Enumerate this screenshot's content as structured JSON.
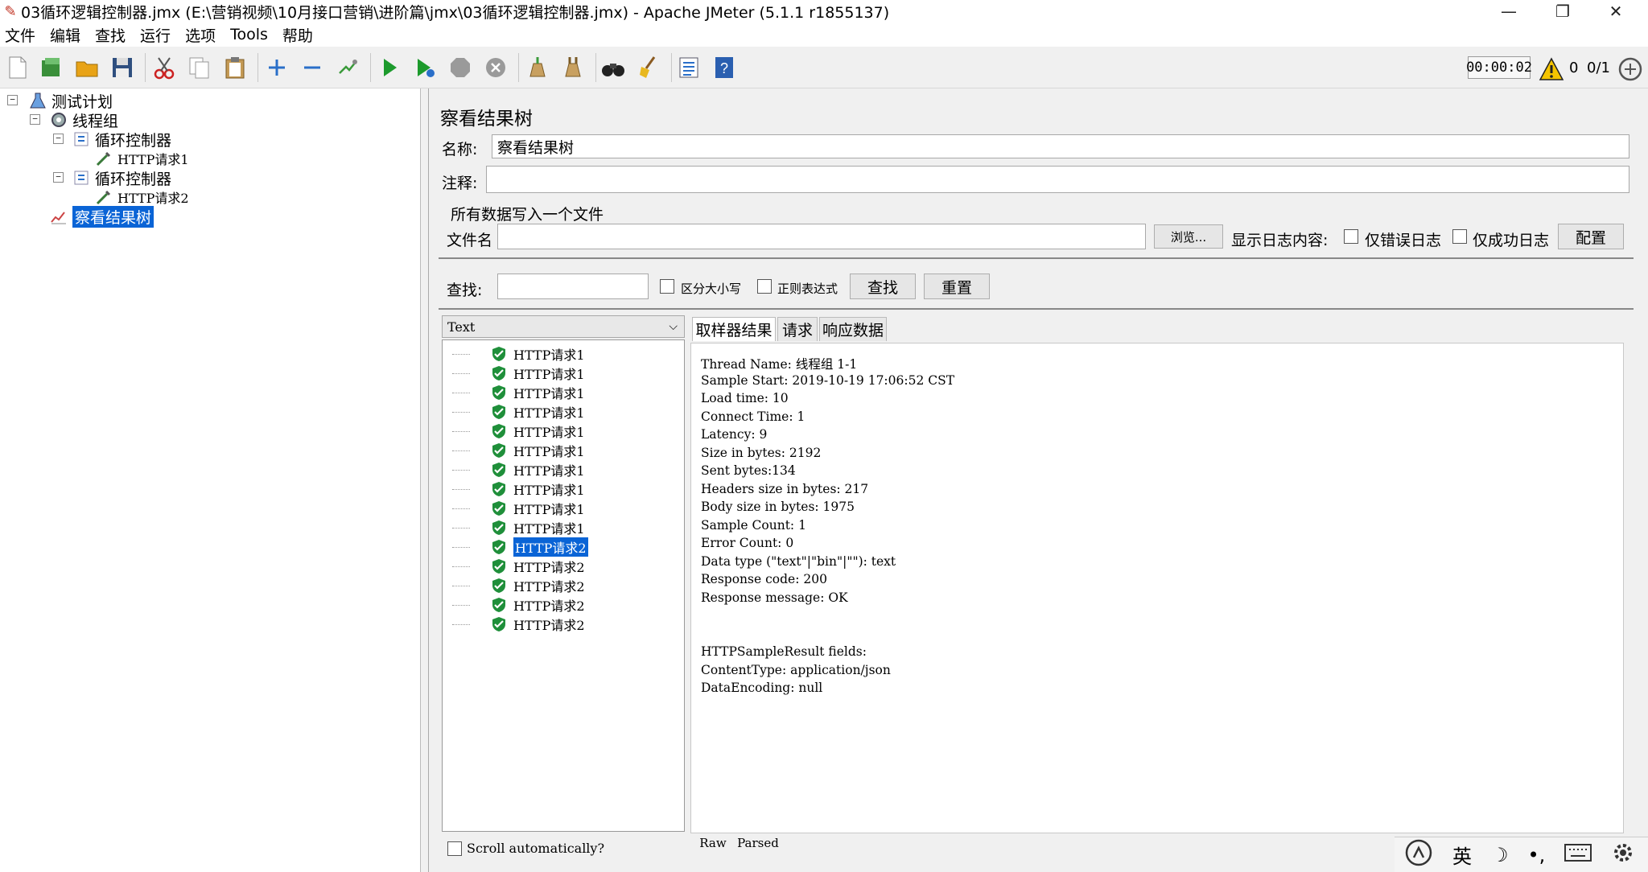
{
  "window": {
    "title": "03循环逻辑控制器.jmx (E:\\营销视频\\10月接口营销\\进阶篇\\jmx\\03循环逻辑控制器.jmx) - Apache JMeter (5.1.1 r1855137)",
    "minimize": "—",
    "restore": "❐",
    "close": "✕"
  },
  "menu": [
    "文件",
    "编辑",
    "查找",
    "运行",
    "选项",
    "Tools",
    "帮助"
  ],
  "toolbar": {
    "timer": "00:00:02",
    "warning_count": "0",
    "threads": "0/1"
  },
  "tree": {
    "root": "测试计划",
    "thread_group": "线程组",
    "loop1": "循环控制器",
    "req1": "HTTP请求1",
    "loop2": "循环控制器",
    "req2": "HTTP请求2",
    "listener": "察看结果树",
    "expander_minus": "−"
  },
  "panel": {
    "title": "察看结果树",
    "name_label": "名称:",
    "name_value": "察看结果树",
    "comment_label": "注释:",
    "comment_value": "",
    "file_section": "所有数据写入一个文件",
    "file_label": "文件名",
    "file_value": "",
    "browse": "浏览...",
    "log_label": "显示日志内容:",
    "errors_only": "仅错误日志",
    "success_only": "仅成功日志",
    "configure": "配置",
    "search_label": "查找:",
    "search_value": "",
    "case_sensitive": "区分大小写",
    "regex": "正则表达式",
    "find_button": "查找",
    "reset_button": "重置"
  },
  "results": {
    "renderer": "Text",
    "items": [
      "HTTP请求1",
      "HTTP请求1",
      "HTTP请求1",
      "HTTP请求1",
      "HTTP请求1",
      "HTTP请求1",
      "HTTP请求1",
      "HTTP请求1",
      "HTTP请求1",
      "HTTP请求1",
      "HTTP请求2",
      "HTTP请求2",
      "HTTP请求2",
      "HTTP请求2",
      "HTTP请求2"
    ],
    "selected_index": 10,
    "scroll_auto": "Scroll automatically?"
  },
  "tabs": [
    "取样器结果",
    "请求",
    "响应数据"
  ],
  "detail_lines": [
    "Thread Name: 线程组 1-1",
    "Sample Start: 2019-10-19 17:06:52 CST",
    "Load time: 10",
    "Connect Time: 1",
    "Latency: 9",
    "Size in bytes: 2192",
    "Sent bytes:134",
    "Headers size in bytes: 217",
    "Body size in bytes: 1975",
    "Sample Count: 1",
    "Error Count: 0",
    "Data type (\"text\"|\"bin\"|\"\"): text",
    "Response code: 200",
    "Response message: OK",
    "",
    "",
    "HTTPSampleResult fields:",
    "ContentType: application/json",
    "DataEncoding: null"
  ],
  "subtabs": [
    "Raw",
    "Parsed"
  ],
  "ime": {
    "lang": "英",
    "moon": "☽",
    "punct": "•,"
  }
}
